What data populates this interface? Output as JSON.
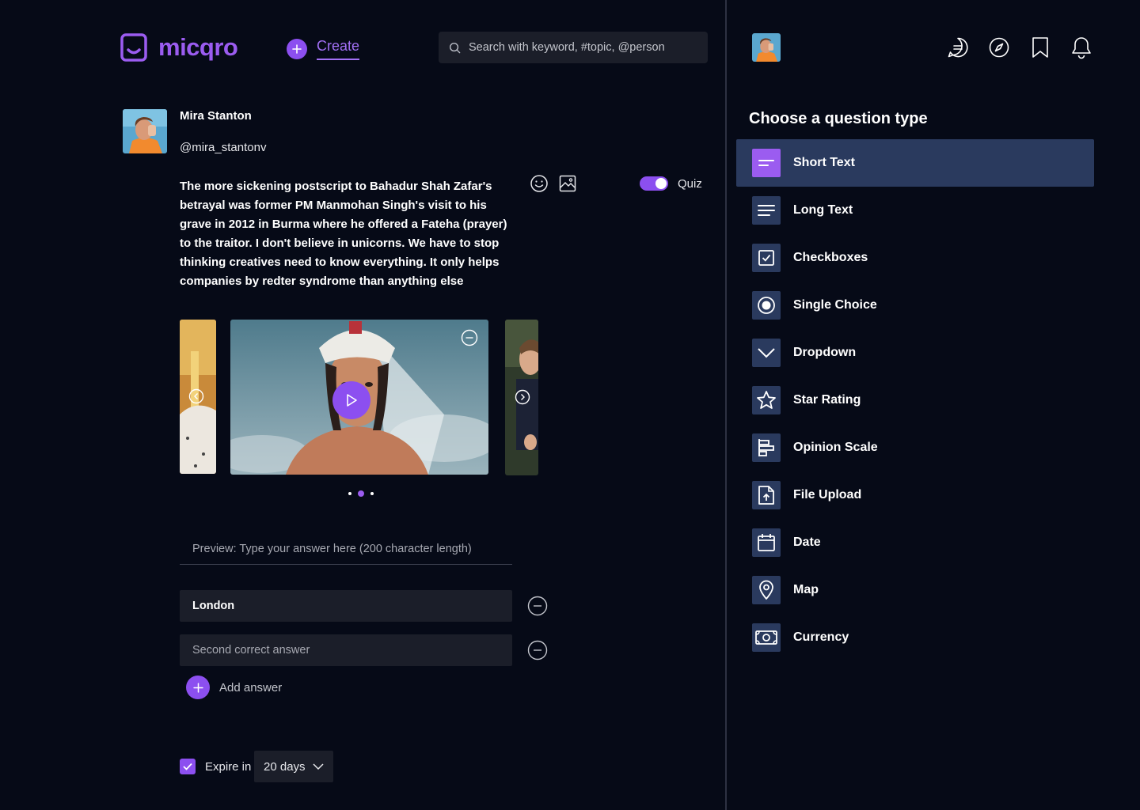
{
  "header": {
    "brand": "micqro",
    "create_label": "Create",
    "search_placeholder": "Search with keyword, #topic, @person"
  },
  "post": {
    "author_name": "Mira Stanton",
    "author_handle": "@mira_stantonv",
    "text": "The more sickening postscript to Bahadur Shah Zafar's betrayal was former PM Manmohan Singh's visit to his grave in 2012 in Burma where he offered a Fateha (prayer) to the traitor. I don't believe in unicorns. We have to stop thinking creatives need to know everything. It only helps companies by redter syndrome than anything else",
    "quiz_label": "Quiz",
    "quiz_enabled": true,
    "carousel": {
      "slides": 3,
      "active_index": 1
    },
    "answer_preview": "Preview: Type your answer here (200 character length)",
    "answers": [
      {
        "value": "London",
        "placeholder": ""
      },
      {
        "value": "",
        "placeholder": "Second correct answer"
      }
    ],
    "add_answer_label": "Add answer",
    "expire": {
      "checked": true,
      "label": "Expire in",
      "value": "20 days"
    }
  },
  "panel": {
    "title": "Choose  a question type",
    "question_types": [
      {
        "label": "Short Text",
        "icon": "short-text-icon",
        "active": true
      },
      {
        "label": "Long Text",
        "icon": "long-text-icon",
        "active": false
      },
      {
        "label": "Checkboxes",
        "icon": "checkbox-icon",
        "active": false
      },
      {
        "label": "Single Choice",
        "icon": "radio-icon",
        "active": false
      },
      {
        "label": "Dropdown",
        "icon": "chevron-down-icon",
        "active": false
      },
      {
        "label": "Star Rating",
        "icon": "star-icon",
        "active": false
      },
      {
        "label": "Opinion Scale",
        "icon": "opinion-scale-icon",
        "active": false
      },
      {
        "label": "File Upload",
        "icon": "file-upload-icon",
        "active": false
      },
      {
        "label": "Date",
        "icon": "calendar-icon",
        "active": false
      },
      {
        "label": "Map",
        "icon": "map-pin-icon",
        "active": false
      },
      {
        "label": "Currency",
        "icon": "currency-icon",
        "active": false
      }
    ]
  },
  "colors": {
    "background": "#060a17",
    "accent": "#8c4ff0",
    "panel_highlight": "#2a3a5e",
    "field": "#1b1e29"
  }
}
